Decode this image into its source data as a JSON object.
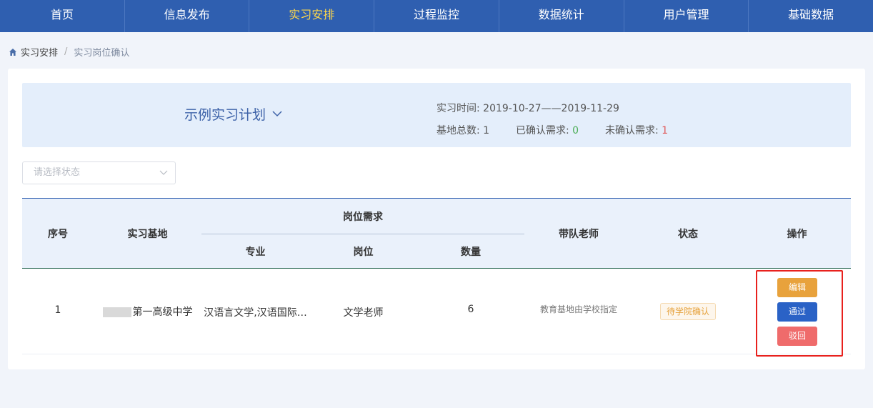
{
  "nav": [
    {
      "label": "首页"
    },
    {
      "label": "信息发布"
    },
    {
      "label": "实习安排",
      "active": true
    },
    {
      "label": "过程监控"
    },
    {
      "label": "数据统计"
    },
    {
      "label": "用户管理"
    },
    {
      "label": "基础数据"
    }
  ],
  "breadcrumb": {
    "home_label": "实习安排",
    "separator": "/",
    "current": "实习岗位确认"
  },
  "plan": {
    "name": "示例实习计划",
    "time_label": "实习时间:",
    "time_value": "2019-10-27——2019-11-29",
    "base_total_label": "基地总数:",
    "base_total": "1",
    "confirmed_label": "已确认需求:",
    "confirmed": "0",
    "unconfirmed_label": "未确认需求:",
    "unconfirmed": "1"
  },
  "filter": {
    "status_placeholder": "请选择状态"
  },
  "table": {
    "headers": {
      "index": "序号",
      "base": "实习基地",
      "demand_group": "岗位需求",
      "major": "专业",
      "position": "岗位",
      "quantity": "数量",
      "teacher": "带队老师",
      "status": "状态",
      "ops": "操作"
    },
    "rows": [
      {
        "index": "1",
        "base": "第一高级中学",
        "major": "汉语言文学,汉语国际…",
        "position": "文学老师",
        "quantity": "6",
        "teacher": "教育基地由学校指定",
        "status": "待学院确认",
        "actions": {
          "edit": "编辑",
          "pass": "通过",
          "reject": "驳回"
        }
      }
    ]
  },
  "colors": {
    "nav_bg": "#2f5fb0",
    "nav_active": "#ffd84a",
    "confirmed": "#4cad57",
    "unconfirmed": "#e05a5a",
    "edit_btn": "#e8a23c",
    "pass_btn": "#2a62c6",
    "reject_btn": "#ef6b6b",
    "highlight_border": "#e8211d"
  }
}
